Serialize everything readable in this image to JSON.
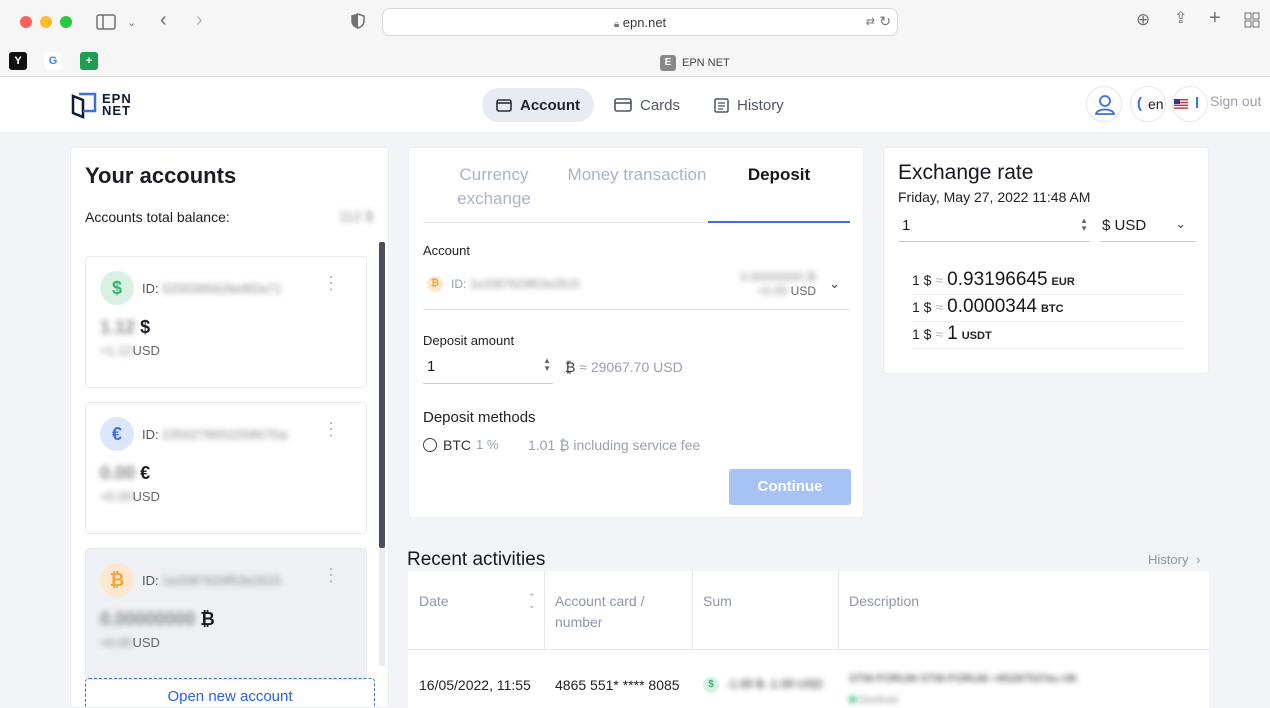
{
  "browser": {
    "url": "epn.net",
    "tab_title": "EPN NET",
    "tab_favicon_letter": "E",
    "bookmarks": [
      "Y",
      "G",
      "+"
    ]
  },
  "app": {
    "logo_line1": "EPN",
    "logo_line2": "NET",
    "nav": [
      {
        "label": "Account",
        "icon": "wallet-icon",
        "active": true
      },
      {
        "label": "Cards",
        "icon": "card-icon",
        "active": false
      },
      {
        "label": "History",
        "icon": "document-icon",
        "active": false
      }
    ],
    "language": "en",
    "sign_out": "Sign out"
  },
  "accounts": {
    "title": "Your accounts",
    "total_label": "Accounts total balance:",
    "total_value": "112 $",
    "items": [
      {
        "coin": "$",
        "id_label": "ID:",
        "id": "5200395626e8f2a71",
        "balance": "1.12",
        "symbol": "$",
        "usd_prefix": "≈1.12",
        "usd": "USD"
      },
      {
        "coin": "€",
        "id_label": "ID:",
        "id": "235027865225867Da",
        "balance": "0.00",
        "symbol": "€",
        "usd_prefix": "≈0.00",
        "usd": "USD"
      },
      {
        "coin": "₿",
        "id_label": "ID:",
        "id": "1e2087629f53e2615",
        "balance": "0.00000000",
        "symbol": "₿",
        "usd_prefix": "≈0.00",
        "usd": "USD"
      }
    ],
    "open_new": "Open new account"
  },
  "deposit": {
    "tabs": [
      "Currency exchange",
      "Money transaction",
      "Deposit"
    ],
    "active_tab": 2,
    "account_label": "Account",
    "account_id_label": "ID:",
    "account_id": "1e2087629f53e2615",
    "account_balance": "0.00000000 ₿",
    "account_usd_value": "≈0.00",
    "account_usd": "USD",
    "amount_label": "Deposit amount",
    "amount_value": "1",
    "amount_currency": "₿",
    "amount_approx": "≈ 29067.70 USD",
    "methods_label": "Deposit methods",
    "method_name": "BTC",
    "method_pct": "1 %",
    "method_fee": "1.01 ₿ including service fee",
    "continue": "Continue"
  },
  "exchange": {
    "title": "Exchange rate",
    "date": "Friday, May 27, 2022 11:48 AM",
    "amount": "1",
    "currency": "$ USD",
    "rows": [
      {
        "one": "1 $",
        "approx": "≈",
        "value": "0.93196645",
        "cur": "EUR"
      },
      {
        "one": "1 $",
        "approx": "≈",
        "value": "0.0000344",
        "cur": "BTC"
      },
      {
        "one": "1 $",
        "approx": "≈",
        "value": "1",
        "cur": "USDT"
      }
    ]
  },
  "activities": {
    "title": "Recent activities",
    "history_link": "History",
    "columns": [
      "Date",
      "Account card / number",
      "Sum",
      "Description"
    ],
    "rows": [
      {
        "date": "16/05/2022, 11:55",
        "card": "4865 551* **** 8085",
        "sum": "-1.00 $",
        "sum_usd": "-1.00 USD",
        "description": "STW-FORUM STW-FORUM +85287537eu HK",
        "status": "Declined"
      }
    ]
  },
  "colors": {
    "accent": "#3d6ee8",
    "usd_coin": "#34b76c",
    "eur_coin": "#3d6ee8",
    "btc_coin": "#f4a43b"
  }
}
